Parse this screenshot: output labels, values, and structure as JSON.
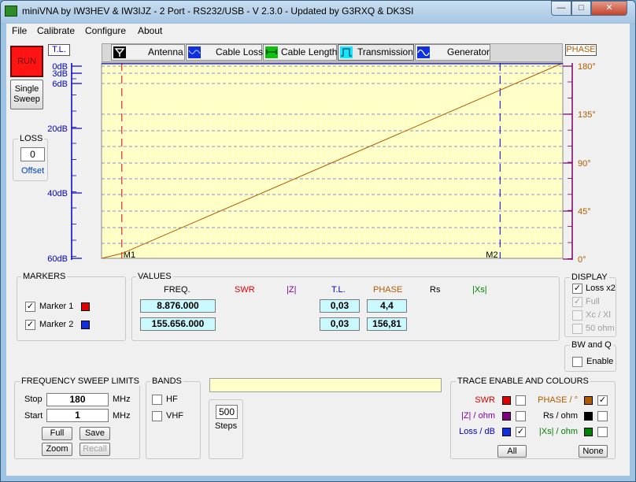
{
  "window": {
    "title": "miniVNA by IW3HEV & IW3IJZ - 2 Port - RS232/USB - V 2.3.0 - Updated by G3RXQ & DK3SI"
  },
  "menu": [
    "File",
    "Calibrate",
    "Configure",
    "About"
  ],
  "run_label": "RUN",
  "single_sweep_label": [
    "Single",
    "Sweep"
  ],
  "loss": {
    "title": "LOSS",
    "value": "0",
    "offset_label": "Offset"
  },
  "tabs": [
    {
      "label": "Antenna",
      "icon": "antenna-icon"
    },
    {
      "label": "Cable Loss",
      "icon": "cable-loss-icon"
    },
    {
      "label": "Cable Length",
      "icon": "cable-length-icon"
    },
    {
      "label": "Transmission",
      "icon": "transmission-icon",
      "selected": true
    },
    {
      "label": "Generator",
      "icon": "generator-icon"
    }
  ],
  "chart_data": {
    "type": "line",
    "left_axis_label": "T.L.",
    "right_axis_label": "PHASE",
    "left_ticks": [
      "0dB",
      "3dB",
      "6dB",
      "20dB",
      "40dB",
      "60dB"
    ],
    "right_ticks": [
      "180°",
      "135°",
      "90°",
      "45°",
      "0°"
    ],
    "x_range_mhz": [
      1,
      180
    ],
    "phase_range_deg": [
      0,
      180
    ],
    "series": [
      {
        "name": "PHASE",
        "color": "#b05a00",
        "x": [
          1,
          8.876,
          180
        ],
        "y": [
          0,
          4.4,
          180
        ]
      },
      {
        "name": "T.L.",
        "color": "#0000cc",
        "x": [
          1,
          180
        ],
        "y": [
          0.03,
          0.03
        ]
      }
    ],
    "markers": [
      {
        "label": "M1",
        "freq_mhz": 8.876,
        "color": "#e00000"
      },
      {
        "label": "M2",
        "freq_mhz": 155.656,
        "color": "#0000cc"
      }
    ],
    "plot_bg": "#ffffc8"
  },
  "markers_panel": {
    "title": "MARKERS",
    "items": [
      {
        "label": "Marker 1",
        "checked": true,
        "color": "#e00000"
      },
      {
        "label": "Marker 2",
        "checked": true,
        "color": "#1030e0"
      }
    ]
  },
  "values_panel": {
    "title": "VALUES",
    "headers": {
      "freq": "FREQ.",
      "swr": "SWR",
      "z": "|Z|",
      "tl": "T.L.",
      "phase": "PHASE",
      "rs": "Rs",
      "xs": "|Xs|"
    },
    "header_colors": {
      "swr": "#e00000",
      "z": "#8000a0",
      "tl": "#0000cc",
      "phase": "#b05a00",
      "rs": "#000000",
      "xs": "#008000"
    },
    "rows": [
      {
        "freq": "8.876.000",
        "tl": "0,03",
        "phase": "4,4"
      },
      {
        "freq": "155.656.000",
        "tl": "0,03",
        "phase": "156,81"
      }
    ]
  },
  "display_panel": {
    "title": "DISPLAY",
    "items": [
      {
        "label": "Loss x2",
        "checked": true,
        "enabled": true
      },
      {
        "label": "Full",
        "checked": true,
        "enabled": false
      },
      {
        "label": "Xc / Xl",
        "checked": false,
        "enabled": false
      },
      {
        "label": "50 ohm",
        "checked": false,
        "enabled": false
      }
    ]
  },
  "bwq_panel": {
    "title": "BW and Q",
    "enable_label": "Enable"
  },
  "freq_sweep": {
    "title": "FREQUENCY SWEEP LIMITS",
    "stop_label": "Stop",
    "stop_value": "180",
    "start_label": "Start",
    "start_value": "1",
    "unit": "MHz",
    "buttons": [
      "Full",
      "Save",
      "Zoom",
      "Recall"
    ]
  },
  "bands": {
    "title": "BANDS",
    "items": [
      "HF",
      "VHF"
    ]
  },
  "steps": {
    "value": "500",
    "label": "Steps"
  },
  "trace_panel": {
    "title": "TRACE ENABLE AND COLOURS",
    "items": [
      {
        "label": "SWR",
        "color": "#e00000",
        "label_color": "#e00000",
        "checked": false
      },
      {
        "label": "PHASE / °",
        "color": "#b05a00",
        "label_color": "#b05a00",
        "checked": true
      },
      {
        "label": "|Z| / ohm",
        "color": "#800080",
        "label_color": "#8000a0",
        "checked": false
      },
      {
        "label": "Rs / ohm",
        "color": "#000000",
        "label_color": "#000000",
        "checked": false
      },
      {
        "label": "Loss / dB",
        "color": "#1030e0",
        "label_color": "#0000cc",
        "checked": true
      },
      {
        "label": "|Xs| / ohm",
        "color": "#008000",
        "label_color": "#008000",
        "checked": false
      }
    ],
    "all_label": "All",
    "none_label": "None"
  }
}
